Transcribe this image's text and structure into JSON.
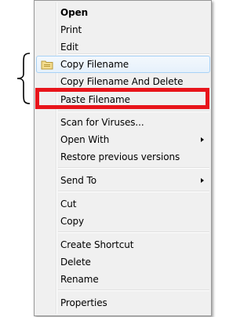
{
  "menu": {
    "items": [
      {
        "label": "Open",
        "bold": true
      },
      {
        "label": "Print"
      },
      {
        "label": "Edit"
      },
      {
        "label": "Copy Filename",
        "icon": "folder-icon",
        "highlighted": true
      },
      {
        "label": "Copy Filename And Delete"
      },
      {
        "label": "Paste Filename"
      },
      {
        "label": "Scan for Viruses..."
      },
      {
        "label": "Open With",
        "submenu": true
      },
      {
        "label": "Restore previous versions"
      },
      {
        "label": "Send To",
        "submenu": true
      },
      {
        "label": "Cut"
      },
      {
        "label": "Copy"
      },
      {
        "label": "Create Shortcut"
      },
      {
        "label": "Delete"
      },
      {
        "label": "Rename"
      },
      {
        "label": "Properties"
      }
    ]
  },
  "annotations": {
    "highlight_color": "#e8151b",
    "brace": "curly-brace-icon"
  }
}
